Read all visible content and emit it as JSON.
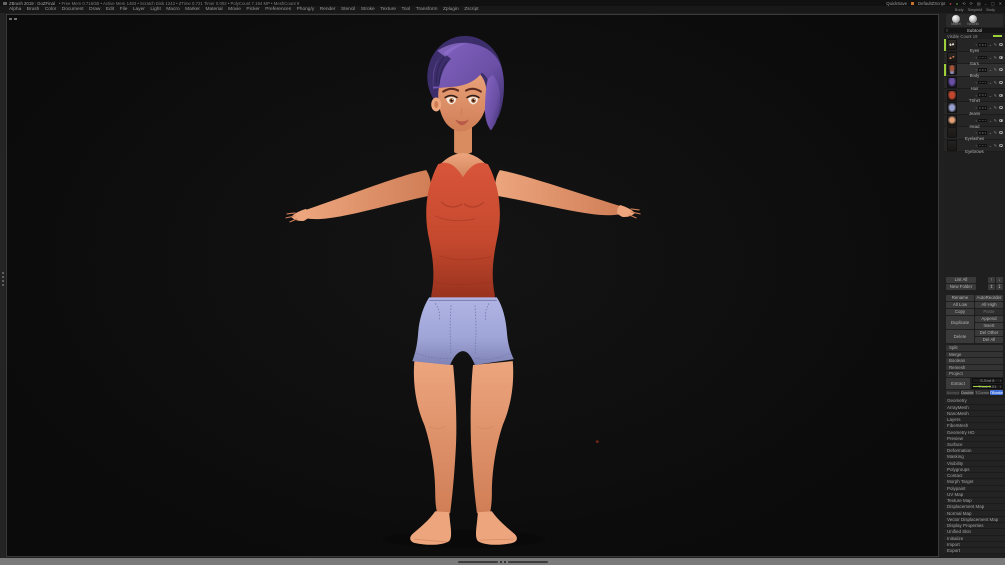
{
  "title_bar": {
    "title": "ZBrush 2019 : GoZFinal",
    "stats": "• Free Mem 0.716GB  • Active Mem 1483  • Scratch Disk 1243  • ZTime 0.721  Timer 0.002  • PolyCount 7.194 MP  • MeshCount 9",
    "quicksave_label": "QuickSave",
    "zscript_label": "DefaultZScript"
  },
  "icons": {
    "flyout": "≡",
    "slider_left": "‹",
    "slider_caret": "⌄",
    "pencil": "✎",
    "up": "↑",
    "down": "↓",
    "up2": "↥",
    "down2": "↧",
    "min": "–",
    "max": "▢",
    "close": "✕",
    "undo": "⟲",
    "redo": "⟳",
    "grid": "▤",
    "dot": "●",
    "corner": "▪"
  },
  "menubar": {
    "items": [
      "Alpha",
      "Brush",
      "Color",
      "Document",
      "Draw",
      "Edit",
      "File",
      "Layer",
      "Light",
      "Macro",
      "Marker",
      "Material",
      "Movie",
      "Picker",
      "Preferences",
      "Phong/y",
      "Render",
      "Stencil",
      "Stroke",
      "Texture",
      "Tool",
      "Transform",
      "Zplugin",
      "Zscript"
    ],
    "right_labels": [
      "Body",
      "SimpleM",
      "Body"
    ]
  },
  "tool_preview": {
    "thumbs": [
      {
        "label": "Materi"
      },
      {
        "label": "NoSelB"
      }
    ]
  },
  "subtool": {
    "header": "Subtool",
    "count_label": "Visible Count 19",
    "items": [
      {
        "name": "Eyes",
        "left_bar": true,
        "active": false,
        "thumb": "background:radial-gradient(circle at 30% 52%, #ddd8cb 0 15%, rgba(0,0,0,0) 16%),radial-gradient(circle at 64% 48%, #ddd8cb 0 15%, rgba(0,0,0,0) 16%),linear-gradient(#2f2b27,#1d1a17)"
      },
      {
        "name": "Ears",
        "left_bar": false,
        "active": false,
        "thumb": "background:radial-gradient(circle at 32% 58%, #c7794f 0 13%, rgba(0,0,0,0) 14%),radial-gradient(circle at 66% 42%, #c7794f 0 13%, rgba(0,0,0,0) 14%),linear-gradient(#282522,#191614)"
      },
      {
        "name": "Body",
        "left_bar": true,
        "active": true,
        "thumb": "background:radial-gradient(ellipse at 50% 35%, #a8543a 0 26%, rgba(0,0,0,0) 55%),radial-gradient(ellipse at 50% 75%, #8d90bb 0 20%, rgba(0,0,0,0) 48%),linear-gradient(#2a2522,#171412)"
      },
      {
        "name": "Hair",
        "left_bar": false,
        "active": false,
        "thumb": "background:radial-gradient(ellipse at 50% 38%, #6a4fa5 0 38%, rgba(0,0,0,0) 72%),linear-gradient(#262238,#161322)"
      },
      {
        "name": "TShirt",
        "left_bar": false,
        "active": false,
        "thumb": "background:radial-gradient(ellipse at 50% 45%, #c24730 0 42%, rgba(0,0,0,0) 78%),linear-gradient(#2c1e1a,#1a1210)"
      },
      {
        "name": "Jeans",
        "left_bar": false,
        "active": false,
        "thumb": "background:radial-gradient(ellipse at 50% 52%, #9aa0cc 0 40%, rgba(0,0,0,0) 76%),linear-gradient(#25252e,#16161c)"
      },
      {
        "name": "Head",
        "left_bar": false,
        "active": false,
        "thumb": "background:radial-gradient(circle at 50% 45%, #e0a078 0 34%, rgba(0,0,0,0) 70%),linear-gradient(#2a2420,#181411)"
      },
      {
        "name": "Eyelashes",
        "left_bar": false,
        "active": false,
        "thumb": "background:linear-gradient(#242220,#1b1918)"
      },
      {
        "name": "Eyebrows",
        "left_bar": false,
        "active": false,
        "thumb": "background:linear-gradient(#242220,#1b1918)"
      }
    ]
  },
  "subtool_buttons": {
    "list_all": "List All",
    "new_folder": "New Folder",
    "rename": "Rename",
    "autoreorder": "AutoReorder",
    "all_low": "All Low",
    "all_high": "All High",
    "copy": "Copy",
    "paste": "Paste",
    "duplicate": "Duplicate",
    "append": "Append",
    "insert": "Insert",
    "delete": "Delete",
    "del_other": "Del Other",
    "del_all": "Del All"
  },
  "sections": [
    "Split",
    "Merge",
    "Boolean",
    "Remesh",
    "Project"
  ],
  "extract": {
    "button": "Extract",
    "sliders": [
      {
        "label": "S.Smt 5",
        "fill": false
      },
      {
        "label": "Thick 0.01",
        "fill": true
      }
    ],
    "toggles": [
      {
        "label": "Accept",
        "variant": "dim"
      },
      {
        "label": "Double",
        "variant": "normal"
      },
      {
        "label": "TCorner",
        "variant": "dark"
      },
      {
        "label": "TBorder",
        "variant": "active"
      }
    ]
  },
  "palette_sections": [
    "Geometry",
    "ArrayMesh",
    "NanoMesh",
    "Layers",
    "FiberMesh",
    "Geometry HD",
    "Preview",
    "Surface",
    "Deformation",
    "Masking",
    "Visibility",
    "Polygroups",
    "Contact",
    "Morph Target",
    "Polypaint",
    "UV Map",
    "Texture Map",
    "Displacement Map",
    "Normal Map",
    "Vector Displacement Map",
    "Display Properties",
    "Unified Skin",
    "Initialize",
    "Import",
    "Export"
  ],
  "viewport": {
    "description": "Stylized female character in T-pose with short purple hair, red tank top and light blue shorts, barefoot, on dark canvas",
    "colors": {
      "hair": "#6a4fa5",
      "hair_dark": "#3c2e6a",
      "skin": "#eca57d",
      "skin_shade": "#d07e56",
      "top": "#c5492e",
      "top_dark": "#94301d",
      "shorts": "#a0a5d8",
      "shorts_dark": "#7e82b4",
      "background": "#0d0d0d"
    }
  },
  "accent": {
    "green": "#9ccf3a",
    "blue": "#3f6fd8"
  }
}
